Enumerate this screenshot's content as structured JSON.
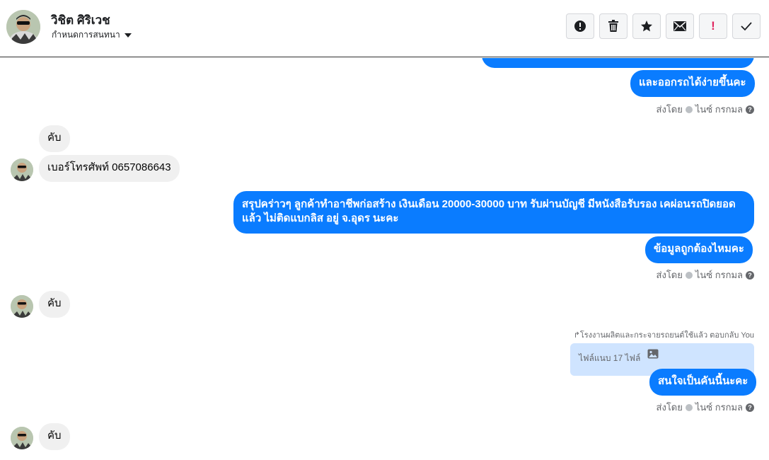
{
  "header": {
    "contact_name": "วิชิต ศิริเวช",
    "subtitle": "กำหนดการสนทนา",
    "toolbar_icons": [
      "alert-circle-icon",
      "trash-icon",
      "star-icon",
      "envelope-icon",
      "exclamation-icon",
      "check-icon"
    ],
    "exclamation_label": "!"
  },
  "thread": {
    "out1": "และออกรถได้ง่ายขึ้นคะ",
    "meta_prefix": "ส่งโดย",
    "meta_sender": "ไนซ์ กรกมล",
    "in1": "คับ",
    "in2": "เบอร์โทรศัพท์ 0657086643",
    "out2_line1": "สรุปคร่าวๆ ลูกค้าทำอาชีพก่อสร้าง เงินเดือน 20000-30000 บาท รับผ่านบัญชี มีหนังสือรับรอง เคผ่อนรถปิดยอด",
    "out2_line2": "แล้ว ไม่ติดแบกลิส อยู่ จ.อุดร นะคะ",
    "out3": "ข้อมูลถูกต้องไหมคะ",
    "in3": "คับ",
    "reply_note": "โรงงานผลิตและกระจายรถยนต์ใช้แล้ว ตอบกลับ You",
    "attachment_label": "ไฟล์แนบ 17 ไฟล์",
    "out4": "สนใจเป็นคันนี้นะคะ",
    "in4": "คับ"
  },
  "colors": {
    "outgoing": "#0a7cff",
    "incoming": "#f0f0f0",
    "attachment": "#cfe4ff"
  }
}
